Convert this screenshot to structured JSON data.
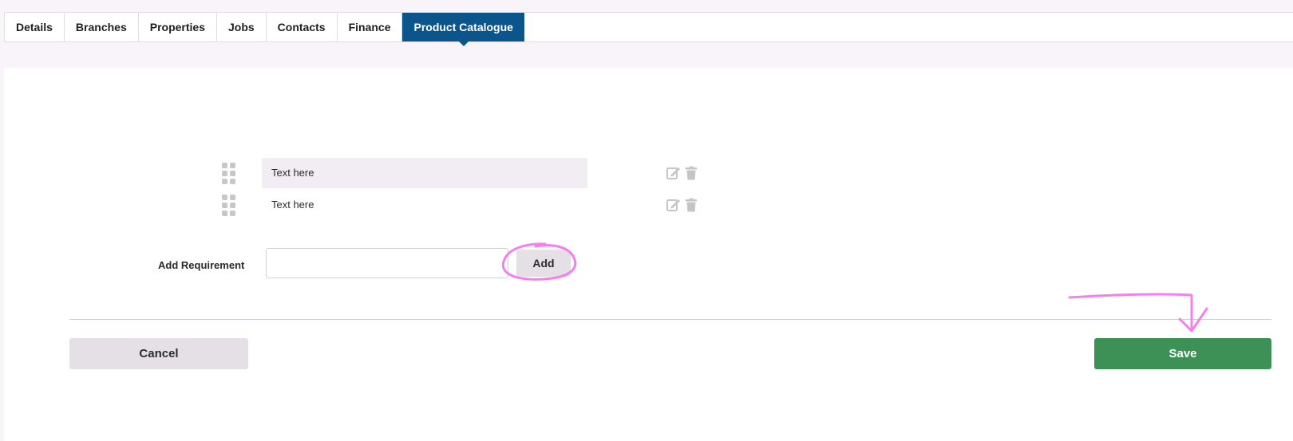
{
  "tabs": [
    {
      "label": "Details"
    },
    {
      "label": "Branches"
    },
    {
      "label": "Properties"
    },
    {
      "label": "Jobs"
    },
    {
      "label": "Contacts"
    },
    {
      "label": "Finance"
    },
    {
      "label": "Product Catalogue",
      "active": true
    }
  ],
  "requirements": [
    {
      "text": "Text here"
    },
    {
      "text": "Text here"
    }
  ],
  "icons": {
    "drag": "drag-handle-icon",
    "edit": "edit-icon",
    "delete": "trash-icon"
  },
  "add_requirement": {
    "label": "Add Requirement",
    "input_value": "",
    "button_label": "Add"
  },
  "footer": {
    "cancel_label": "Cancel",
    "save_label": "Save"
  },
  "colors": {
    "active_tab": "#0c558c",
    "save_button": "#3d9156",
    "secondary_button": "#e4e0e5",
    "highlight_row": "#f2edf3",
    "annotation_pen": "#f47ff0"
  }
}
